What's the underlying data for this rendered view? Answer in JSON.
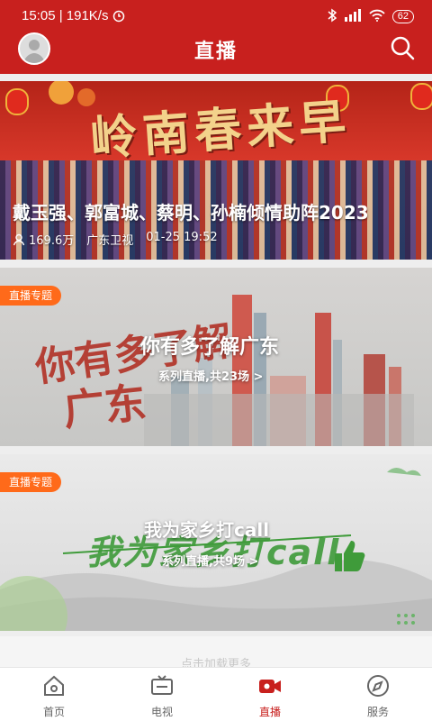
{
  "status_bar": {
    "time_speed": "15:05 | 191K/s",
    "battery": "62"
  },
  "header": {
    "title": "直播"
  },
  "featured": {
    "banner_text": "岭南春来早",
    "headline": "戴玉强、郭富城、蔡明、孙楠倾情助阵2023",
    "views": "169.6万",
    "channel": "广东卫视",
    "datetime": "01-25 19:52"
  },
  "topics": [
    {
      "badge": "直播专题",
      "title": "你有多了解广东",
      "subtitle": "系列直播,共23场 >"
    },
    {
      "badge": "直播专题",
      "title": "我为家乡打call",
      "subtitle": "系列直播,共9场 >"
    }
  ],
  "partial_text": "点击加载更多",
  "bottom_nav": [
    {
      "label": "首页",
      "icon": "home-icon"
    },
    {
      "label": "电视",
      "icon": "tv-icon"
    },
    {
      "label": "直播",
      "icon": "video-camera-icon"
    },
    {
      "label": "服务",
      "icon": "compass-icon"
    }
  ],
  "colors": {
    "brand_red": "#c8201e",
    "badge_orange": "#ff6a1a",
    "call_green": "#3f9b3a"
  }
}
